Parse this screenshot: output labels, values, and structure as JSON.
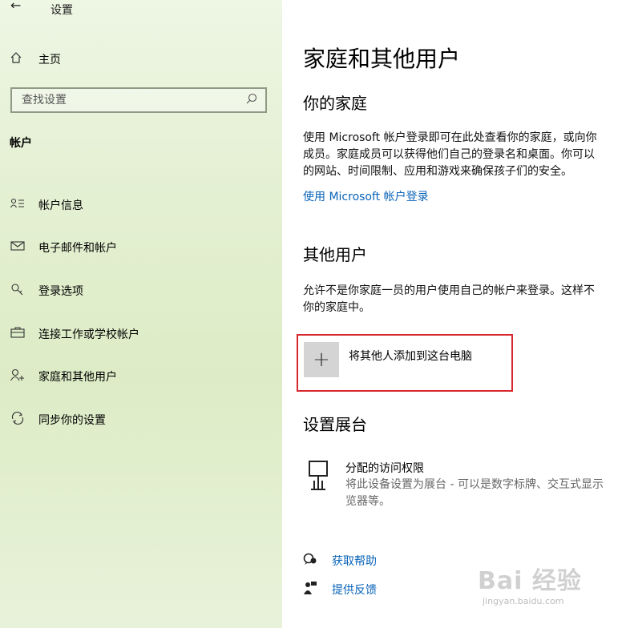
{
  "app": {
    "title": "设置",
    "back_icon": "back-arrow-icon"
  },
  "sidebar": {
    "home": {
      "label": "主页",
      "icon": "home-icon"
    },
    "search": {
      "placeholder": "查找设置",
      "icon": "search-icon"
    },
    "section": "帐户",
    "items": [
      {
        "label": "帐户信息",
        "icon": "person-info-icon"
      },
      {
        "label": "电子邮件和帐户",
        "icon": "mail-icon"
      },
      {
        "label": "登录选项",
        "icon": "key-icon"
      },
      {
        "label": "连接工作或学校帐户",
        "icon": "briefcase-icon"
      },
      {
        "label": "家庭和其他用户",
        "icon": "add-person-icon"
      },
      {
        "label": "同步你的设置",
        "icon": "sync-icon"
      }
    ]
  },
  "main": {
    "title": "家庭和其他用户",
    "family": {
      "heading": "你的家庭",
      "lines": [
        "使用 Microsoft 帐户登录即可在此处查看你的家庭，或向你",
        "成员。家庭成员可以获得他们自己的登录名和桌面。你可以",
        "的网站、时间限制、应用和游戏来确保孩子们的安全。"
      ],
      "link": "使用 Microsoft 帐户登录"
    },
    "others": {
      "heading": "其他用户",
      "lines": [
        "允许不是你家庭一员的用户使用自己的帐户来登录。这样不",
        "你的家庭中。"
      ],
      "add_label": "将其他人添加到这台电脑"
    },
    "kiosk": {
      "heading": "设置展台",
      "title": "分配的访问权限",
      "desc_lines": [
        "将此设备设置为展台 - 可以是数字标牌、交互式显示",
        "览器等。"
      ]
    },
    "help": [
      {
        "label": "获取帮助",
        "icon": "help-chat-icon"
      },
      {
        "label": "提供反馈",
        "icon": "feedback-icon"
      }
    ]
  },
  "watermark": {
    "text": "Bai 经验",
    "sub": "jingyan.baidu.com"
  },
  "colors": {
    "link": "#0a64b8",
    "highlight_border": "#d8282f",
    "sidebar_bg": "#e4f0d3"
  }
}
